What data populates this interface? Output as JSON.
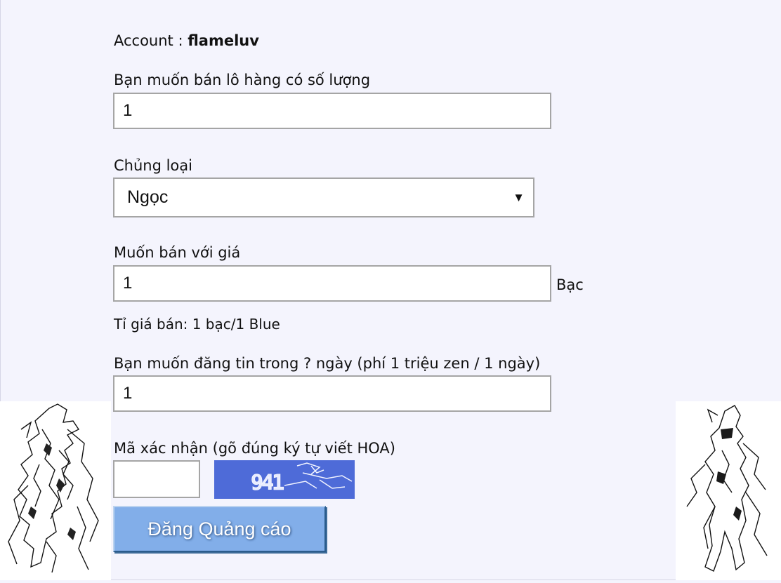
{
  "account": {
    "label": "Account : ",
    "name": "flameluv"
  },
  "quantity": {
    "label": "Bạn muốn bán lô hàng có số lượng",
    "value": "1"
  },
  "category": {
    "label": "Chủng loại",
    "selected": "Ngọc"
  },
  "price": {
    "label": "Muốn bán với giá",
    "value": "1",
    "unit": "Bạc"
  },
  "rate_text": "Tỉ giá bán: 1 bạc/1 Blue",
  "days": {
    "label": "Bạn muốn đăng tin trong ? ngày (phí 1 triệu zen / 1 ngày)",
    "value": "1"
  },
  "captcha": {
    "label": "Mã xác nhận (gõ đúng ký tự viết HOA)",
    "value": "",
    "image_text": "941"
  },
  "submit_label": "Đăng Quảng cáo",
  "colors": {
    "button": "#82aee9",
    "captcha_bg": "#4e6bd8",
    "page_bg": "#f4f4fd"
  }
}
